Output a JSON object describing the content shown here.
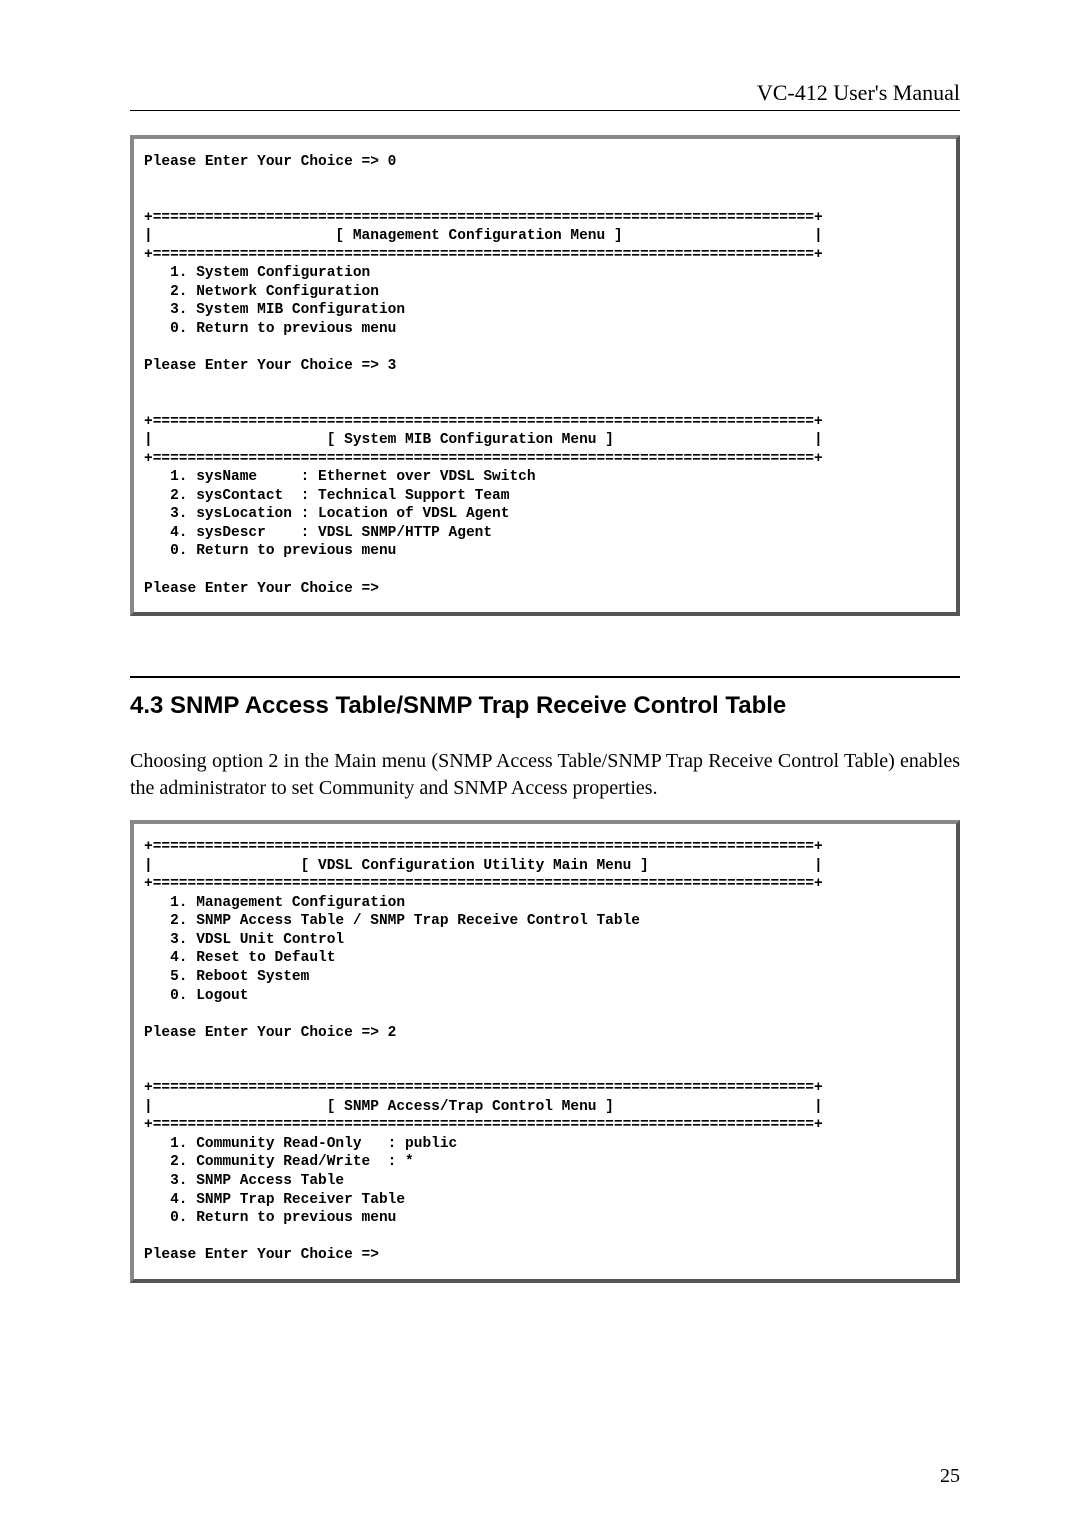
{
  "header": {
    "title": "VC-412  User's Manual"
  },
  "terminal1": {
    "prompt1": "Please Enter Your Choice => 0",
    "rule_top1": "+============================================================================+",
    "banner1": "|                     [ Management Configuration Menu ]                      |",
    "rule_bot1": "+============================================================================+",
    "mgmt_items": [
      "   1. System Configuration",
      "   2. Network Configuration",
      "   3. System MIB Configuration",
      "   0. Return to previous menu"
    ],
    "prompt2": "Please Enter Your Choice => 3",
    "rule_top2": "+============================================================================+",
    "banner2": "|                    [ System MIB Configuration Menu ]                       |",
    "rule_bot2": "+============================================================================+",
    "mib_items": [
      "   1. sysName     : Ethernet over VDSL Switch",
      "   2. sysContact  : Technical Support Team",
      "   3. sysLocation : Location of VDSL Agent",
      "   4. sysDescr    : VDSL SNMP/HTTP Agent",
      "   0. Return to previous menu"
    ],
    "prompt3": "Please Enter Your Choice =>"
  },
  "section": {
    "heading": "4.3 SNMP Access Table/SNMP Trap Receive Control Table",
    "paragraph": "Choosing option 2 in the Main menu (SNMP Access Table/SNMP Trap Receive Control Table) enables the administrator to set Community and SNMP Access properties."
  },
  "terminal2": {
    "rule_top1": "+============================================================================+",
    "banner1": "|                 [ VDSL Configuration Utility Main Menu ]                   |",
    "rule_bot1": "+============================================================================+",
    "main_items": [
      "   1. Management Configuration",
      "   2. SNMP Access Table / SNMP Trap Receive Control Table",
      "   3. VDSL Unit Control",
      "   4. Reset to Default",
      "   5. Reboot System",
      "   0. Logout"
    ],
    "prompt1": "Please Enter Your Choice => 2",
    "rule_top2": "+============================================================================+",
    "banner2": "|                    [ SNMP Access/Trap Control Menu ]                       |",
    "rule_bot2": "+============================================================================+",
    "snmp_items": [
      "   1. Community Read-Only   : public",
      "   2. Community Read/Write  : *",
      "   3. SNMP Access Table",
      "   4. SNMP Trap Receiver Table",
      "   0. Return to previous menu"
    ],
    "prompt2": "Please Enter Your Choice =>"
  },
  "page_number": "25"
}
